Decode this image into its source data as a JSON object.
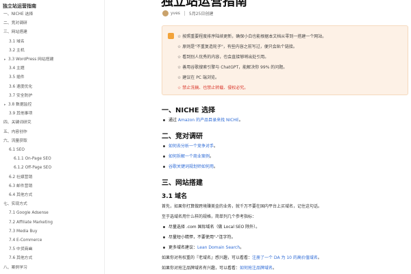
{
  "sidebar": {
    "title": "独立站运营指南",
    "items": [
      {
        "label": "一、NICHE 选择",
        "level": 1
      },
      {
        "label": "二、竞对调研",
        "level": 1
      },
      {
        "label": "三、网站搭建",
        "level": 1
      },
      {
        "label": "3.1 域名",
        "level": 2
      },
      {
        "label": "3.2 主机",
        "level": 2
      },
      {
        "label": "3.3 WordPress 网站搭建",
        "level": 2,
        "caret": "▸"
      },
      {
        "label": "3.4 主题",
        "level": 2
      },
      {
        "label": "3.5 插件",
        "level": 2
      },
      {
        "label": "3.6 速度优化",
        "level": 2
      },
      {
        "label": "3.7 安全防护",
        "level": 2
      },
      {
        "label": "3.8 数据监控",
        "level": 2,
        "caret": "▸"
      },
      {
        "label": "3.9 其他事项",
        "level": 2
      },
      {
        "label": "四、关键词研究",
        "level": 1
      },
      {
        "label": "五、内容创作",
        "level": 1
      },
      {
        "label": "六、流量获取",
        "level": 1
      },
      {
        "label": "6.1 SEO",
        "level": 2
      },
      {
        "label": "6.1.1 On-Page SEO",
        "level": 3
      },
      {
        "label": "6.1.2 Off-Page SEO",
        "level": 3
      },
      {
        "label": "6.2 社媒营销",
        "level": 2
      },
      {
        "label": "6.3 邮件营销",
        "level": 2
      },
      {
        "label": "6.4 其他方式",
        "level": 2
      },
      {
        "label": "七、实现方式",
        "level": 1
      },
      {
        "label": "7.1 Google Adsense",
        "level": 2
      },
      {
        "label": "7.2 Affiliate Marketing",
        "level": 2
      },
      {
        "label": "7.3 Media Buy",
        "level": 2
      },
      {
        "label": "7.4 E-Commerce",
        "level": 2
      },
      {
        "label": "7.5 中货商幽",
        "level": 2
      },
      {
        "label": "7.6 其他方式",
        "level": 2
      },
      {
        "label": "八、案例学习",
        "level": 1
      }
    ]
  },
  "article": {
    "title": "独立站运营指南",
    "author": "yves",
    "date": "5月25日创建",
    "notice": [
      {
        "text": "☆ 按照重要程度排序陆续更新，确保小白也能根据本文档从零到一搭建一个网站。",
        "red": false
      },
      {
        "text": "☆ 原则是\"不重复造轮子\"，有些内容之前写过，便只会贴个链接。",
        "red": false
      },
      {
        "text": "☆ 看到别人优秀的内容，也会直接够哨出处引用。",
        "red": false
      },
      {
        "text": "☆ 善用谷歌搜索引擎与 ChatGPT，能解决你 99% 的问题。",
        "red": false
      },
      {
        "text": "☆ 建议在 PC 端浏览。",
        "red": false
      },
      {
        "text": "☆ 禁止洗稿、也禁止转载、侵权必究。",
        "red": true
      }
    ],
    "section1": {
      "heading": "一、NICHE 选择",
      "bullets": [
        {
          "prefix": "通过 ",
          "link": "Amazon 的产品目录来找 NICHE",
          "suffix": "。"
        }
      ]
    },
    "section2": {
      "heading": "二、竞对调研",
      "bullets": [
        {
          "link": "如何去分析一个竞争对手",
          "suffix": "。"
        },
        {
          "link": "如何拆解一个商业案例",
          "suffix": "。"
        },
        {
          "link": "谷歌关键词规划师如何用",
          "suffix": "。"
        }
      ]
    },
    "section3": {
      "heading": "三、网站搭建",
      "sub1": {
        "heading": "3.1 域名",
        "para1": "首先，如果你打算做跨境赚美金的业务，就千万不要在国内平台上买域名，记住这句话。",
        "para2": "至于选域名用什么样的规格，简单列几个参考指标：",
        "bullets": [
          {
            "text": "尽量选择 .com 国际域名（做 Local SEO 除外）。"
          },
          {
            "text": "尽量短小精悍，不要使用\"-\"连字符。"
          },
          {
            "prefix": "更多域名建议：",
            "link": "Lean Domain Search",
            "suffix": "。"
          }
        ],
        "para3_prefix": "如果你对有权重的『老域名』感兴趣，可以看看：",
        "para3_link": "注册了一个 DA 为 10 的高价值域名",
        "para3_suffix": "。",
        "para4_prefix": "如果你对抢注品牌域名有兴趣，可以看看：",
        "para4_link": "如何抢注品牌域名",
        "para4_suffix": "。"
      }
    }
  }
}
